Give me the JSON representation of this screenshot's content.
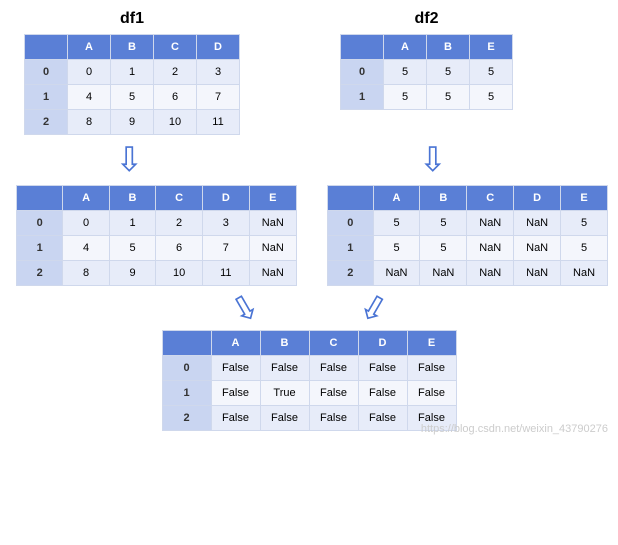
{
  "titles": {
    "df1": "df1",
    "df2": "df2"
  },
  "df1": {
    "columns": [
      "A",
      "B",
      "C",
      "D"
    ],
    "index": [
      "0",
      "1",
      "2"
    ],
    "data": [
      [
        "0",
        "1",
        "2",
        "3"
      ],
      [
        "4",
        "5",
        "6",
        "7"
      ],
      [
        "8",
        "9",
        "10",
        "11"
      ]
    ]
  },
  "df2": {
    "columns": [
      "A",
      "B",
      "E"
    ],
    "index": [
      "0",
      "1"
    ],
    "data": [
      [
        "5",
        "5",
        "5"
      ],
      [
        "5",
        "5",
        "5"
      ]
    ]
  },
  "df1_exp": {
    "columns": [
      "A",
      "B",
      "C",
      "D",
      "E"
    ],
    "index": [
      "0",
      "1",
      "2"
    ],
    "data": [
      [
        "0",
        "1",
        "2",
        "3",
        "NaN"
      ],
      [
        "4",
        "5",
        "6",
        "7",
        "NaN"
      ],
      [
        "8",
        "9",
        "10",
        "11",
        "NaN"
      ]
    ]
  },
  "df2_exp": {
    "columns": [
      "A",
      "B",
      "C",
      "D",
      "E"
    ],
    "index": [
      "0",
      "1",
      "2"
    ],
    "data": [
      [
        "5",
        "5",
        "NaN",
        "NaN",
        "5"
      ],
      [
        "5",
        "5",
        "NaN",
        "NaN",
        "5"
      ],
      [
        "NaN",
        "NaN",
        "NaN",
        "NaN",
        "NaN"
      ]
    ]
  },
  "result": {
    "columns": [
      "A",
      "B",
      "C",
      "D",
      "E"
    ],
    "index": [
      "0",
      "1",
      "2"
    ],
    "data": [
      [
        "False",
        "False",
        "False",
        "False",
        "False"
      ],
      [
        "False",
        "True",
        "False",
        "False",
        "False"
      ],
      [
        "False",
        "False",
        "False",
        "False",
        "False"
      ]
    ]
  },
  "watermark": "https://blog.csdn.net/weixin_43790276"
}
